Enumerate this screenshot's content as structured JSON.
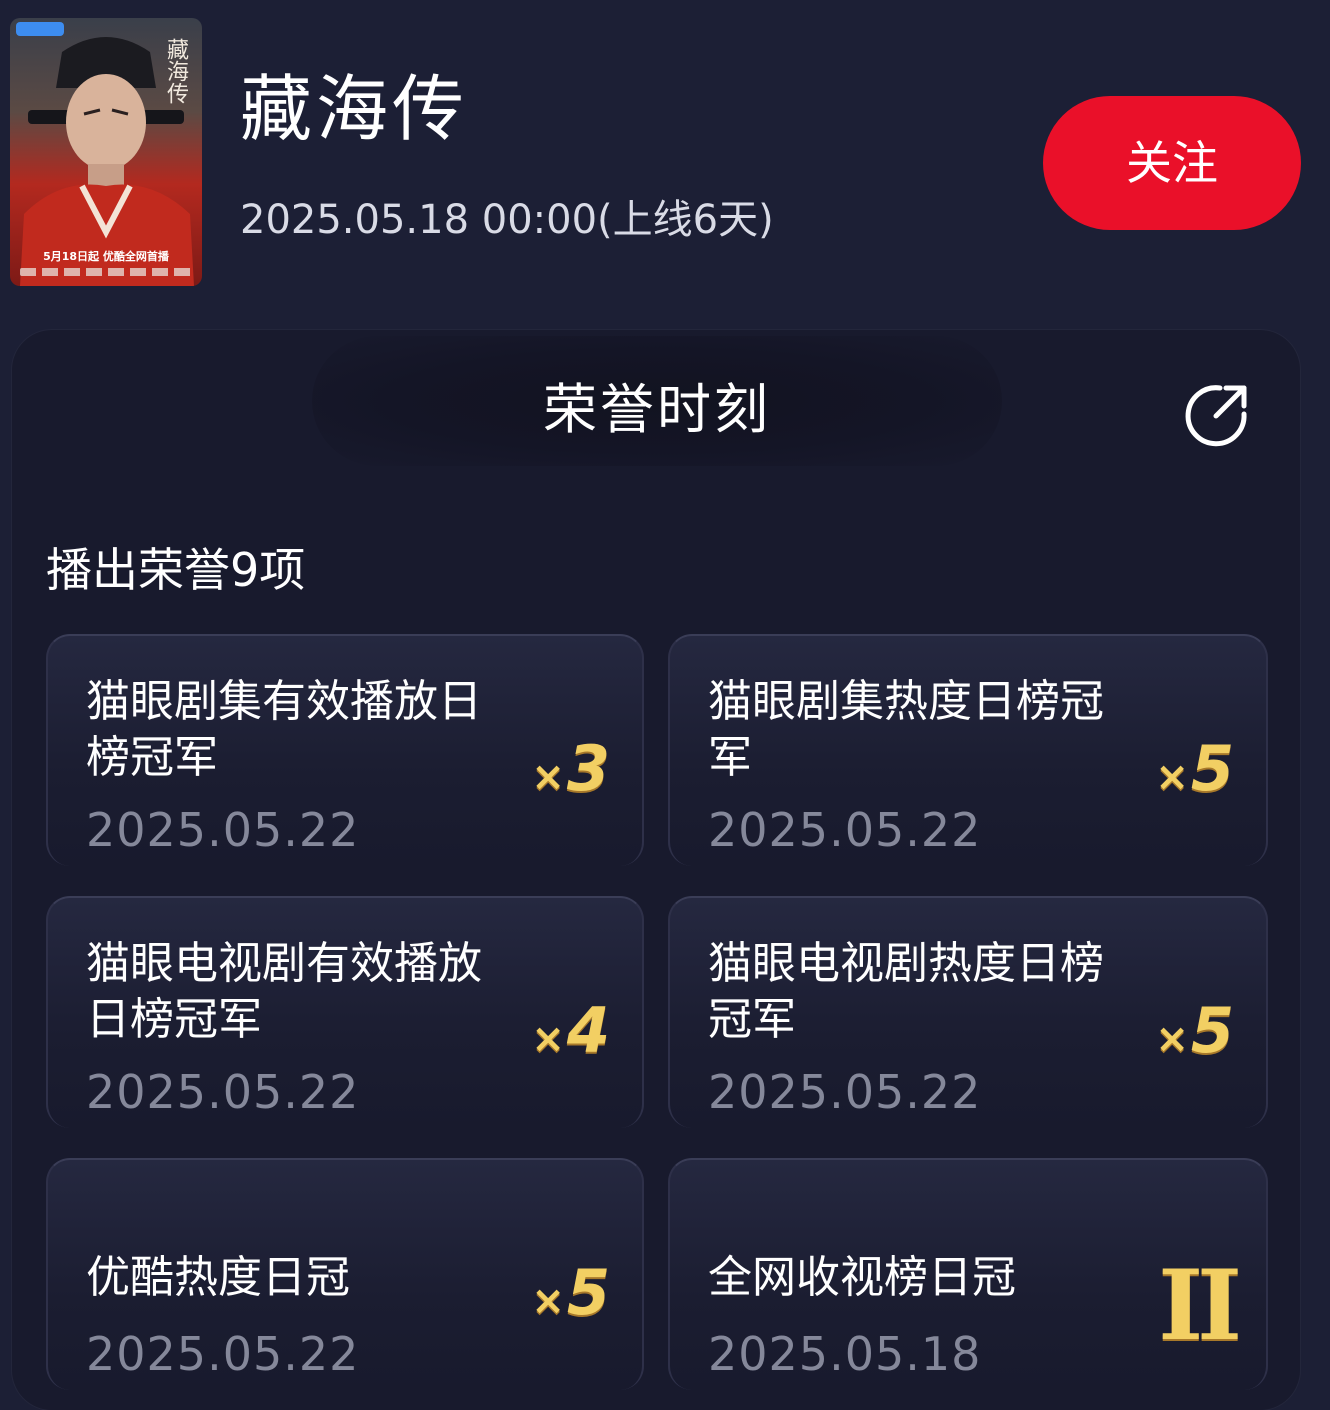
{
  "header": {
    "poster_title": "藏海传",
    "poster_caption": "5月18日起 优酷全网首播",
    "title": "藏海传",
    "release": "2025.05.18 00:00(上线6天)",
    "follow_label": "关注"
  },
  "panel": {
    "title": "荣誉时刻",
    "section_title": "播出荣誉9项"
  },
  "honors": [
    {
      "name": "猫眼剧集有效播放日榜冠军",
      "date": "2025.05.22",
      "count_prefix": "×",
      "count": "3"
    },
    {
      "name": "猫眼剧集热度日榜冠军",
      "date": "2025.05.22",
      "count_prefix": "×",
      "count": "5"
    },
    {
      "name": "猫眼电视剧有效播放日榜冠军",
      "date": "2025.05.22",
      "count_prefix": "×",
      "count": "4"
    },
    {
      "name": "猫眼电视剧热度日榜冠军",
      "date": "2025.05.22",
      "count_prefix": "×",
      "count": "5"
    },
    {
      "name": "优酷热度日冠",
      "date": "2025.05.22",
      "count_prefix": "×",
      "count": "5"
    },
    {
      "name": "全网收视榜日冠",
      "date": "2025.05.18",
      "count_prefix": "",
      "count": "II"
    }
  ],
  "colors": {
    "background": "#1c1f35",
    "panel": "#181a2d",
    "follow_button": "#ea1029",
    "count_gold": "#f2cf63",
    "date_gray": "#85889a"
  },
  "icons": {
    "share": "share-icon"
  }
}
